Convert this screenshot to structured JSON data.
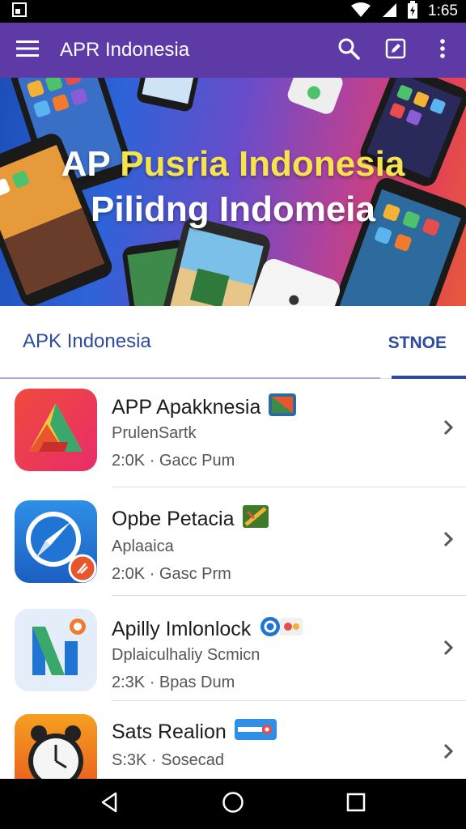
{
  "status_bar": {
    "time": "1:65",
    "icons": [
      "notification-icon",
      "wifi-icon",
      "signal-icon",
      "battery-icon"
    ]
  },
  "app_bar": {
    "title": "APR Indonesia",
    "actions": [
      "search-icon",
      "edit-icon",
      "more-vert-icon"
    ],
    "color": "#5e3aa6"
  },
  "banner": {
    "line1_white": "AP",
    "line1_highlight": "Pusria Indonesia",
    "line2": "Pilidng Indomeia"
  },
  "tabs": {
    "left_label": "APK Indonesia",
    "right_label": "STNOE",
    "accent": "#2e4a9e"
  },
  "apps": [
    {
      "title": "APP Apakknesia",
      "subtitle": "PrulenSartk",
      "meta": "2:0K · Gacc Pum",
      "icon": "triangle-logo-icon"
    },
    {
      "title": "Opbe Petacia",
      "subtitle": "Aplaaica",
      "meta": "2:0K · Gasc Prm",
      "icon": "compass-icon"
    },
    {
      "title": "Apilly Imlonlock",
      "subtitle": "Dplaiculhaliy Scmicn",
      "meta": "2:3K · Bpas Dum",
      "icon": "n-logo-icon"
    },
    {
      "title": "Sats Realion",
      "subtitle": "",
      "meta": "S:3K · Sosecad",
      "icon": "alarm-clock-icon"
    }
  ],
  "nav_bar": {
    "buttons": [
      "back-icon",
      "home-icon",
      "recents-icon"
    ]
  }
}
